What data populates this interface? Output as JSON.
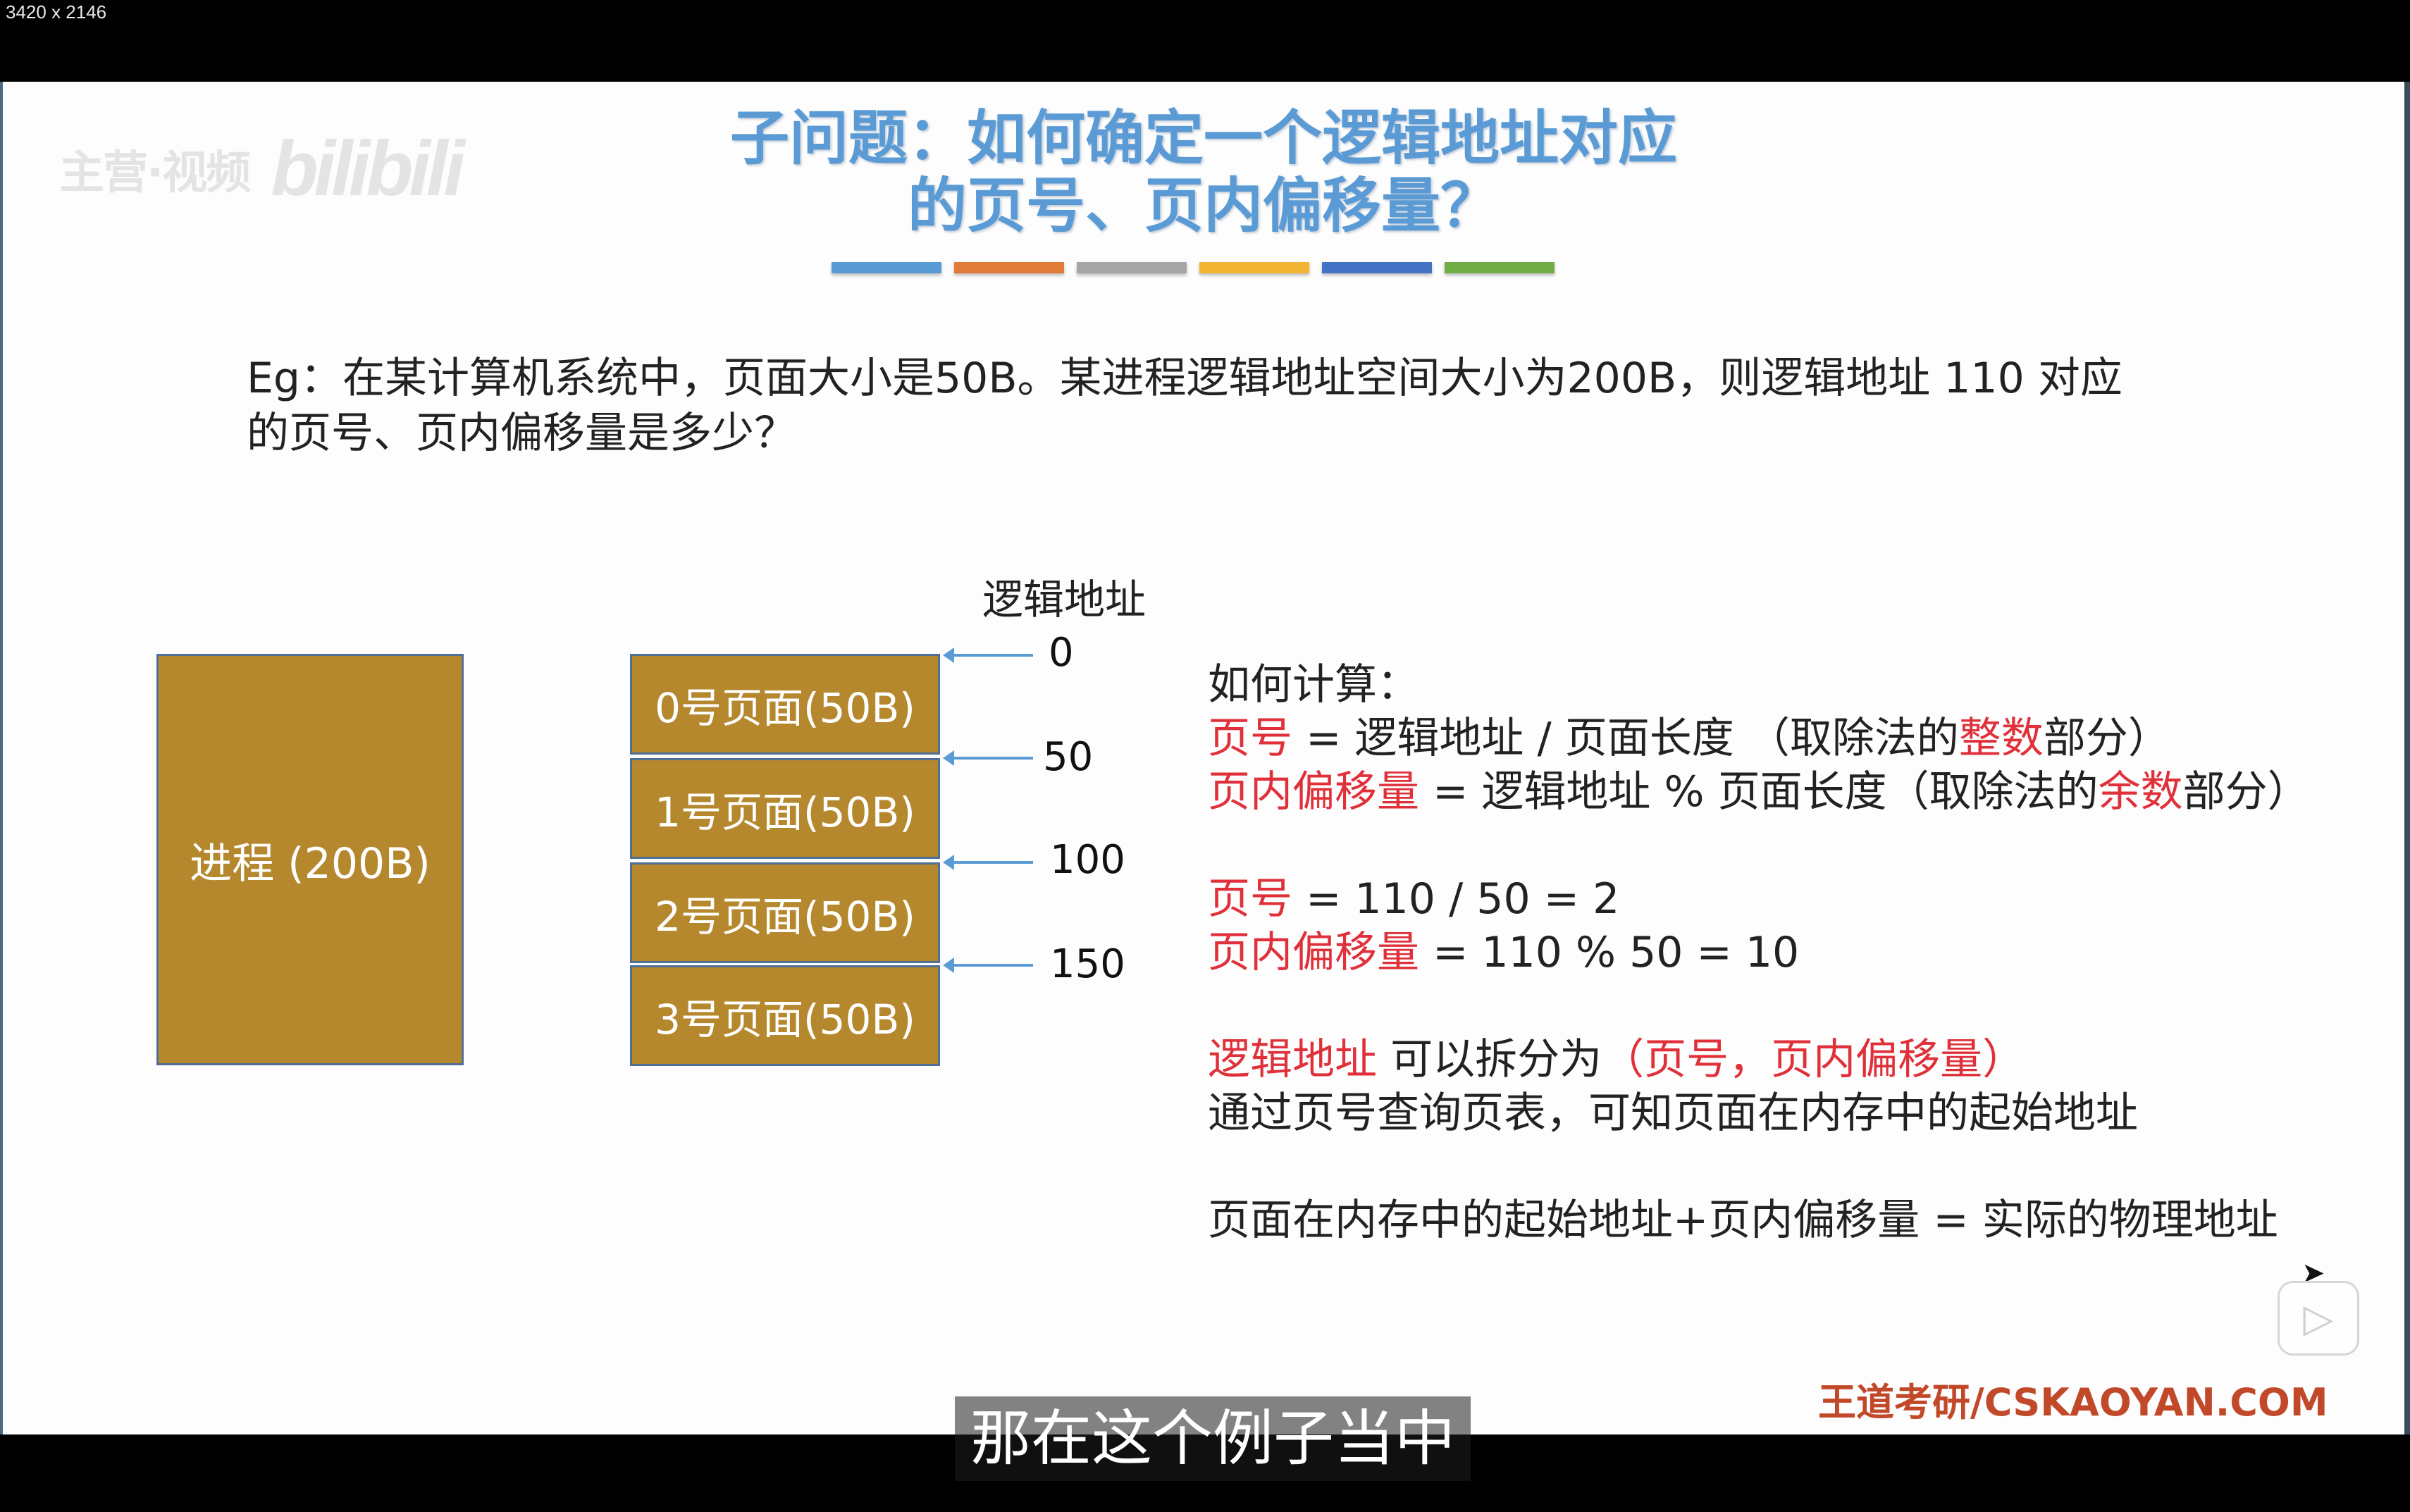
{
  "screen": {
    "dims_label": "3420 x 2146"
  },
  "watermark": {
    "text": "主营·视频",
    "logo": "bilibili"
  },
  "title": {
    "line1": "子问题：如何确定一个逻辑地址对应",
    "line2": "的页号、页内偏移量？"
  },
  "title_bar_colors": [
    "#5b9bd5",
    "#e07b39",
    "#a5a5a5",
    "#f2b533",
    "#4472c4",
    "#70ad47"
  ],
  "question": {
    "line1": "Eg：在某计算机系统中，页面大小是50B。某进程逻辑地址空间大小为200B，则逻辑地址 110 对应",
    "line2": "的页号、页内偏移量是多少？"
  },
  "diagram": {
    "process_label": "进程 (200B)",
    "column_label": "逻辑地址",
    "pages": [
      "0号页面(50B)",
      "1号页面(50B)",
      "2号页面(50B)",
      "3号页面(50B)"
    ],
    "addresses": [
      "0",
      "50",
      "100",
      "150"
    ],
    "box_color": "#b5882e",
    "arrow_color": "#5b9bd5"
  },
  "calc": {
    "heading": "如何计算：",
    "formula1": {
      "p1": "页号",
      "p2": " = 逻辑地址 / 页面长度 （取除法的",
      "p3": "整数",
      "p4": "部分）"
    },
    "formula2": {
      "p1": "页内偏移量",
      "p2": " = 逻辑地址 % 页面长度（取除法的",
      "p3": "余数",
      "p4": "部分）"
    },
    "example1": {
      "p1": "页号",
      "p2": " = 110 / 50 = 2"
    },
    "example2": {
      "p1": "页内偏移量",
      "p2": " = 110 % 50 = 10"
    },
    "split": {
      "p1": "逻辑地址",
      "p2": " 可以拆分为",
      "p3": "（页号，页内偏移量）"
    },
    "lookup": "通过页号查询页表，可知页面在内存中的起始地址",
    "physical": "页面在内存中的起始地址+页内偏移量 = 实际的物理地址",
    "highlight_color": "#e0303a"
  },
  "brand": "王道考研/CSKAOYAN.COM",
  "player": {
    "play_icon": "play-icon",
    "subtitle": "那在这个例子当中"
  }
}
